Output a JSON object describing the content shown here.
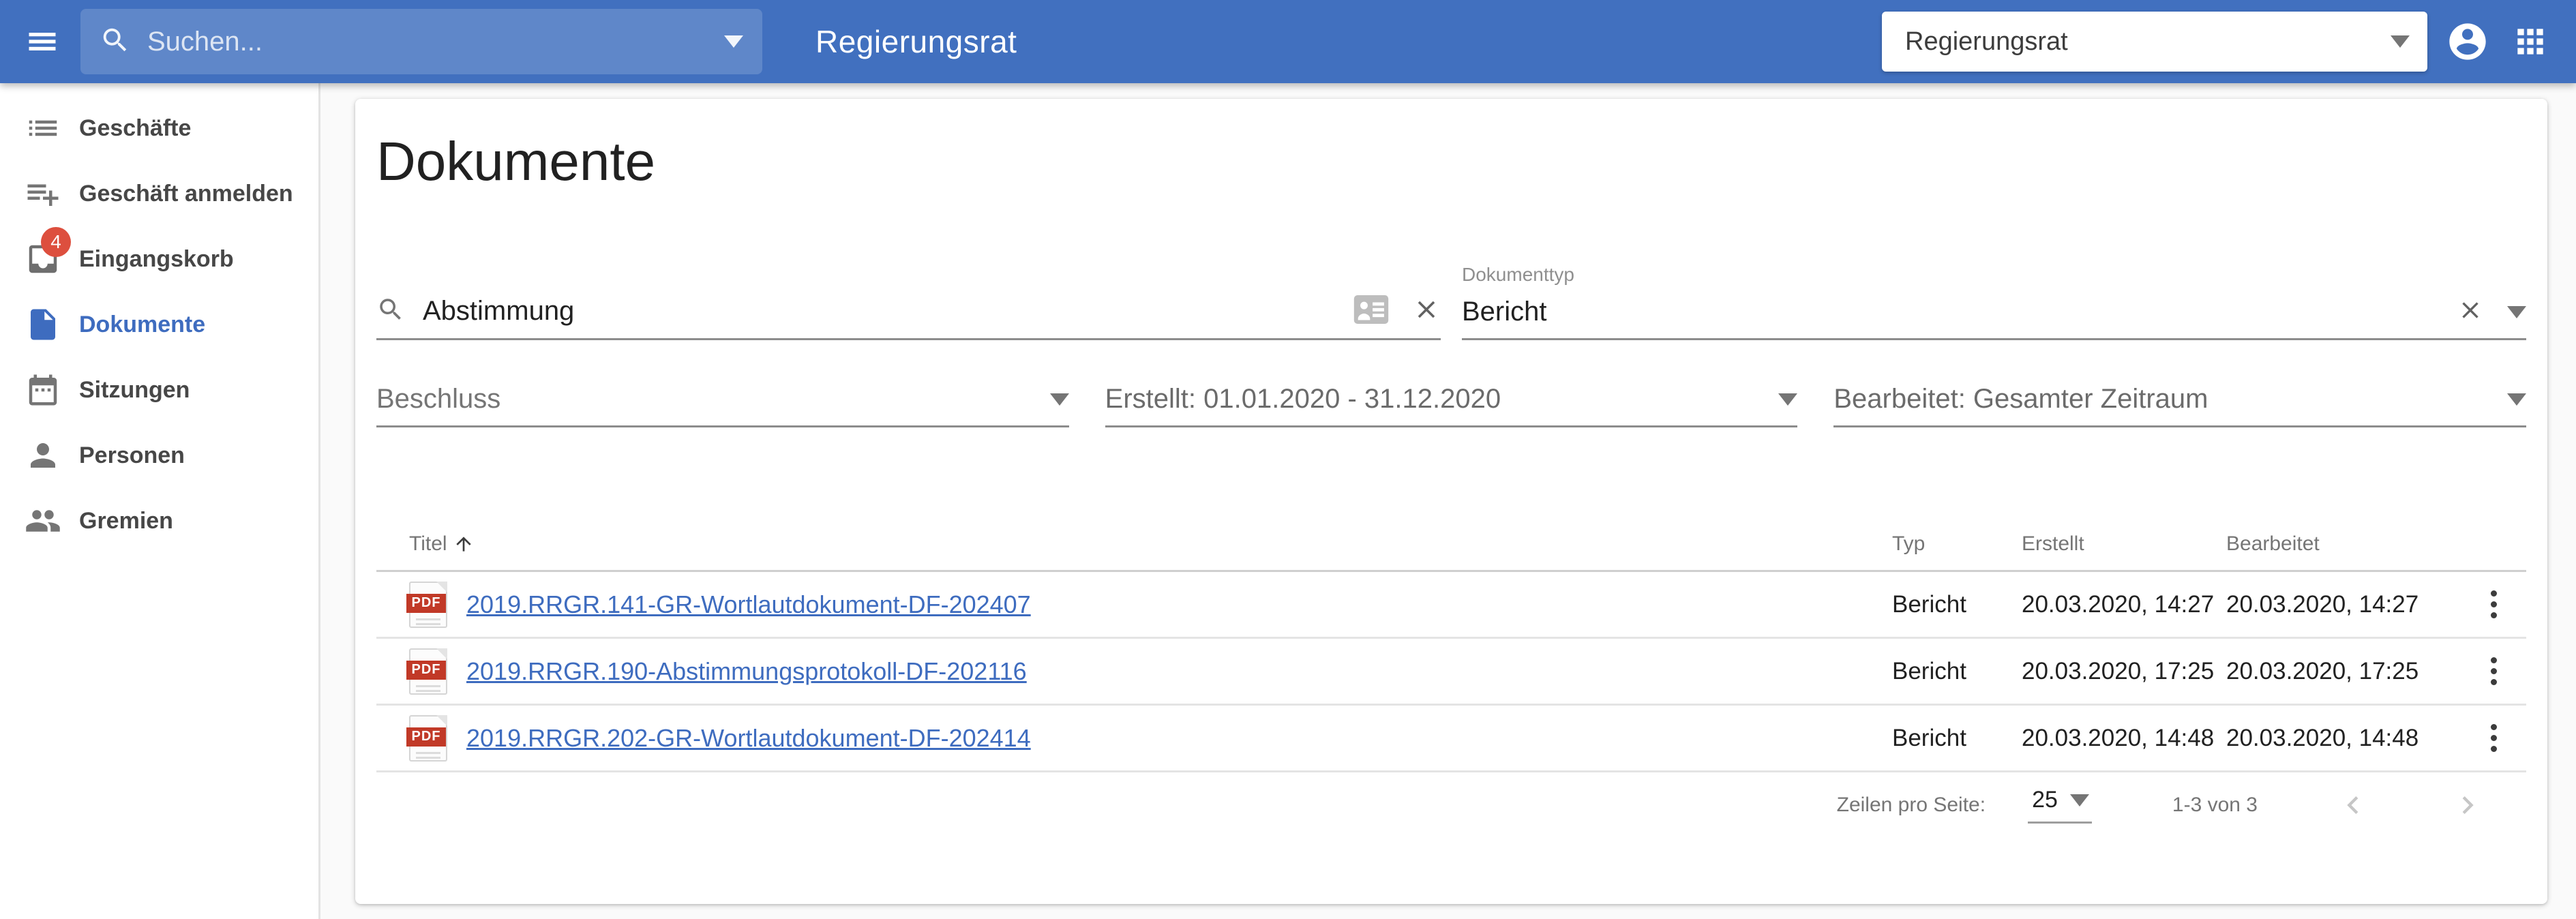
{
  "appbar": {
    "search_placeholder": "Suchen...",
    "title": "Regierungsrat",
    "tenant_select_value": "Regierungsrat"
  },
  "sidebar": {
    "items": [
      {
        "label": "Geschäfte",
        "icon": "list-icon"
      },
      {
        "label": "Geschäft anmelden",
        "icon": "playlist-add-icon"
      },
      {
        "label": "Eingangskorb",
        "icon": "inbox-icon",
        "badge": "4"
      },
      {
        "label": "Dokumente",
        "icon": "document-icon",
        "active": true
      },
      {
        "label": "Sitzungen",
        "icon": "calendar-icon"
      },
      {
        "label": "Personen",
        "icon": "person-icon"
      },
      {
        "label": "Gremien",
        "icon": "people-icon"
      }
    ]
  },
  "main": {
    "title": "Dokumente",
    "filters": {
      "search_value": "Abstimmung",
      "dokumenttyp_label": "Dokumenttyp",
      "dokumenttyp_value": "Bericht",
      "beschluss_placeholder": "Beschluss",
      "erstellt_value": "Erstellt: 01.01.2020 - 31.12.2020",
      "bearbeitet_value": "Bearbeitet: Gesamter Zeitraum"
    },
    "table": {
      "headers": {
        "titel": "Titel",
        "typ": "Typ",
        "erstellt": "Erstellt",
        "bearbeitet": "Bearbeitet"
      },
      "file_type_label": "PDF",
      "rows": [
        {
          "title": "2019.RRGR.141-GR-Wortlautdokument-DF-202407",
          "typ": "Bericht",
          "erstellt": "20.03.2020, 14:27",
          "bearbeitet": "20.03.2020, 14:27"
        },
        {
          "title": "2019.RRGR.190-Abstimmungsprotokoll-DF-202116",
          "typ": "Bericht",
          "erstellt": "20.03.2020, 17:25",
          "bearbeitet": "20.03.2020, 17:25"
        },
        {
          "title": "2019.RRGR.202-GR-Wortlautdokument-DF-202414",
          "typ": "Bericht",
          "erstellt": "20.03.2020, 14:48",
          "bearbeitet": "20.03.2020, 14:48"
        }
      ]
    },
    "pagination": {
      "rows_per_page_label": "Zeilen pro Seite:",
      "rows_per_page_value": "25",
      "range_label": "1-3 von 3"
    }
  },
  "colors": {
    "appbar_blue": "#4170bf",
    "active_blue": "#3e6cbf",
    "link_blue": "#3e6cbf",
    "badge_red": "#dd4f3e",
    "pdf_red": "#c13927"
  }
}
